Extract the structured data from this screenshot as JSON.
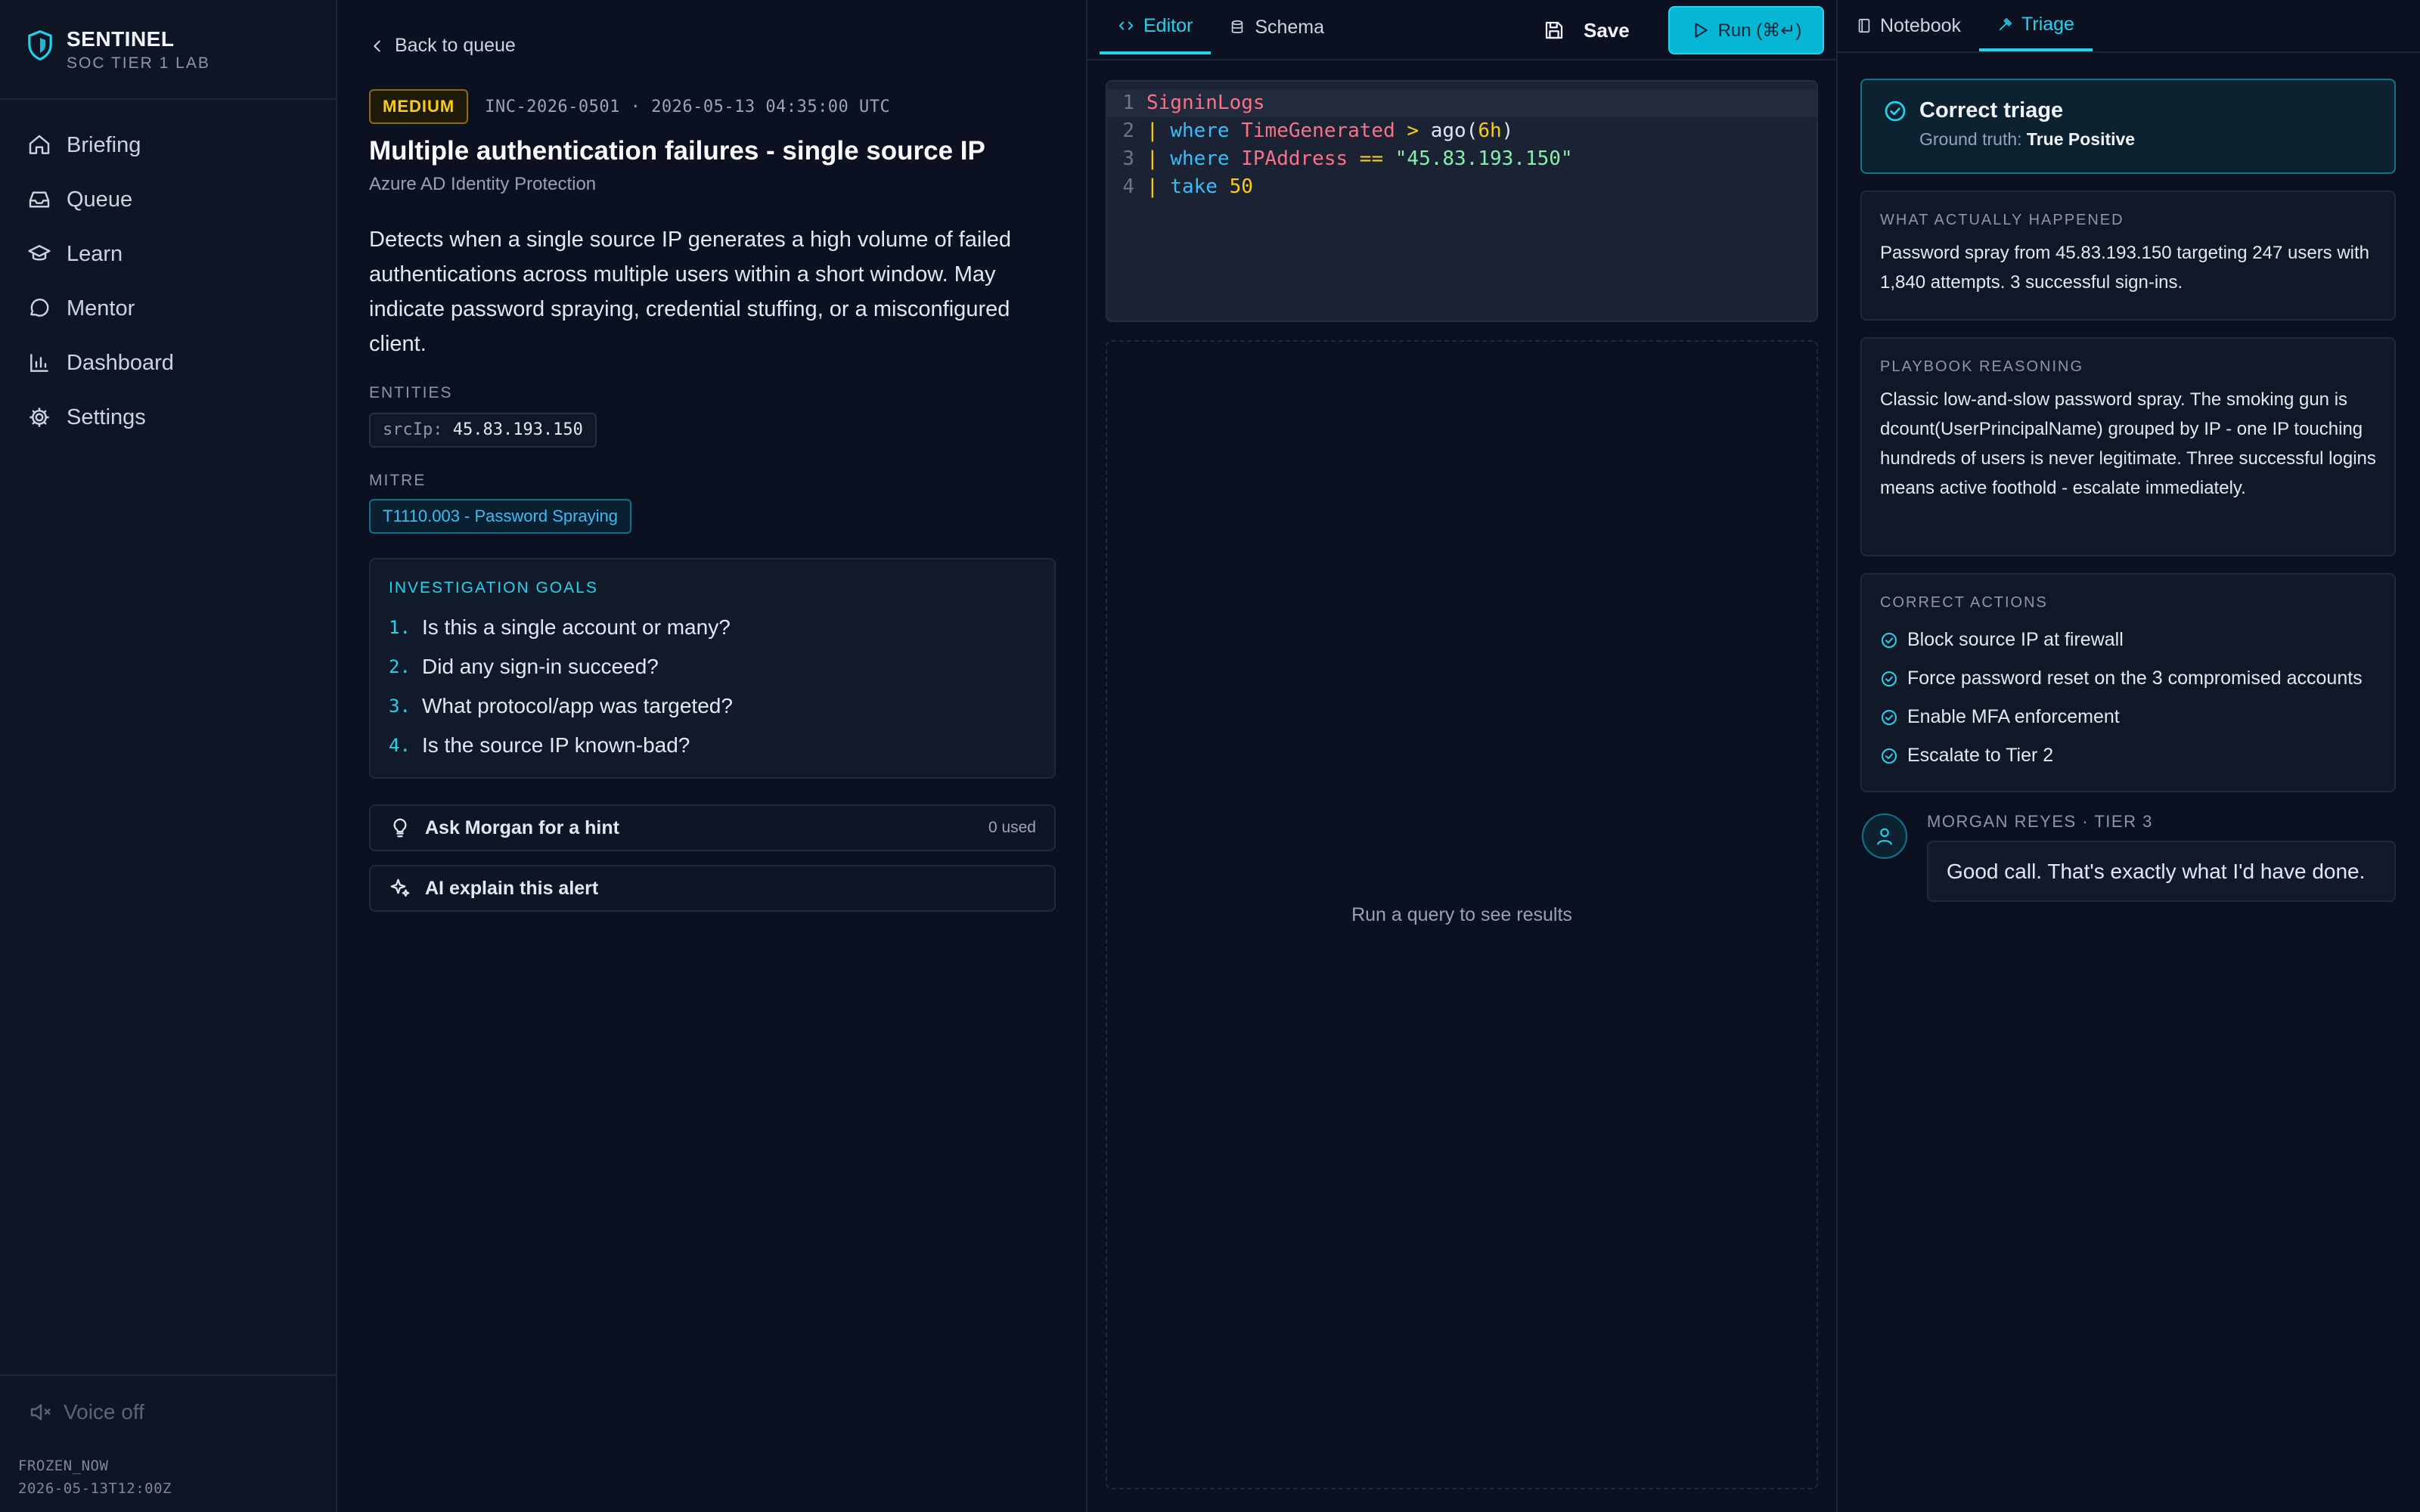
{
  "brand": {
    "name": "SENTINEL",
    "subtitle": "SOC TIER 1 LAB",
    "accent": "#22d3ee"
  },
  "nav": {
    "items": [
      {
        "label": "Briefing",
        "icon": "home-icon"
      },
      {
        "label": "Queue",
        "icon": "inbox-icon"
      },
      {
        "label": "Learn",
        "icon": "graduation-cap-icon"
      },
      {
        "label": "Mentor",
        "icon": "chat-bubble-icon"
      },
      {
        "label": "Dashboard",
        "icon": "bar-chart-icon"
      },
      {
        "label": "Settings",
        "icon": "gear-icon"
      }
    ],
    "voice_label": "Voice off",
    "frozen_label": "FROZEN_NOW",
    "frozen_value": "2026-05-13T12:00Z"
  },
  "alert": {
    "back_label": "Back to queue",
    "severity": "MEDIUM",
    "incident_meta": "INC-2026-0501 · 2026-05-13 04:35:00 UTC",
    "title": "Multiple authentication failures - single source IP",
    "source": "Azure AD Identity Protection",
    "description": "Detects when a single source IP generates a high volume of failed authentications across multiple users within a short window. May indicate password spraying, credential stuffing, or a misconfigured client.",
    "entities_label": "ENTITIES",
    "entity_key": "srcIp:",
    "entity_value": "45.83.193.150",
    "mitre_label": "MITRE",
    "mitre_tag": "T1110.003 - Password Spraying",
    "goals_label": "INVESTIGATION GOALS",
    "goals": [
      {
        "num": "1.",
        "text": "Is this a single account or many?"
      },
      {
        "num": "2.",
        "text": "Did any sign-in succeed?"
      },
      {
        "num": "3.",
        "text": "What protocol/app was targeted?"
      },
      {
        "num": "4.",
        "text": "Is the source IP known-bad?"
      }
    ],
    "hint_label": "Ask Morgan for a hint",
    "hint_used": "0 used",
    "explain_label": "AI explain this alert"
  },
  "editor": {
    "tabs": [
      {
        "label": "Editor"
      },
      {
        "label": "Schema"
      }
    ],
    "save_label": "Save",
    "run_label": "Run (⌘↵)",
    "lines": [
      "1",
      "2",
      "3",
      "4"
    ],
    "code": {
      "table": "SigninLogs",
      "pipe": "|",
      "where": "where",
      "take": "take",
      "field1": "TimeGenerated",
      "gt": ">",
      "fn": "ago(",
      "arg": "6h",
      "close": ")",
      "field2": "IPAddress",
      "eq": "==",
      "ip_str": "\"45.83.193.150\"",
      "limit": "50"
    },
    "results_empty": "Run a query to see results"
  },
  "triage": {
    "tabs": [
      {
        "label": "Notebook"
      },
      {
        "label": "Triage"
      }
    ],
    "verdict_title": "Correct triage",
    "ground_truth_label": "Ground truth:",
    "ground_truth_value": "True Positive",
    "happened_label": "WHAT ACTUALLY HAPPENED",
    "happened_text": "Password spray from 45.83.193.150 targeting 247 users with 1,840 attempts. 3 successful sign-ins.",
    "reasoning_label": "PLAYBOOK REASONING",
    "reasoning_text": "Classic low-and-slow password spray. The smoking gun is dcount(UserPrincipalName) grouped by IP - one IP touching hundreds of users is never legitimate. Three successful logins means active foothold - escalate immediately.",
    "actions_label": "CORRECT ACTIONS",
    "actions": [
      "Block source IP at firewall",
      "Force password reset on the 3 compromised accounts",
      "Enable MFA enforcement",
      "Escalate to Tier 2"
    ],
    "mentor_name": "MORGAN REYES · TIER 3",
    "mentor_message": "Good call. That's exactly what I'd have done."
  }
}
